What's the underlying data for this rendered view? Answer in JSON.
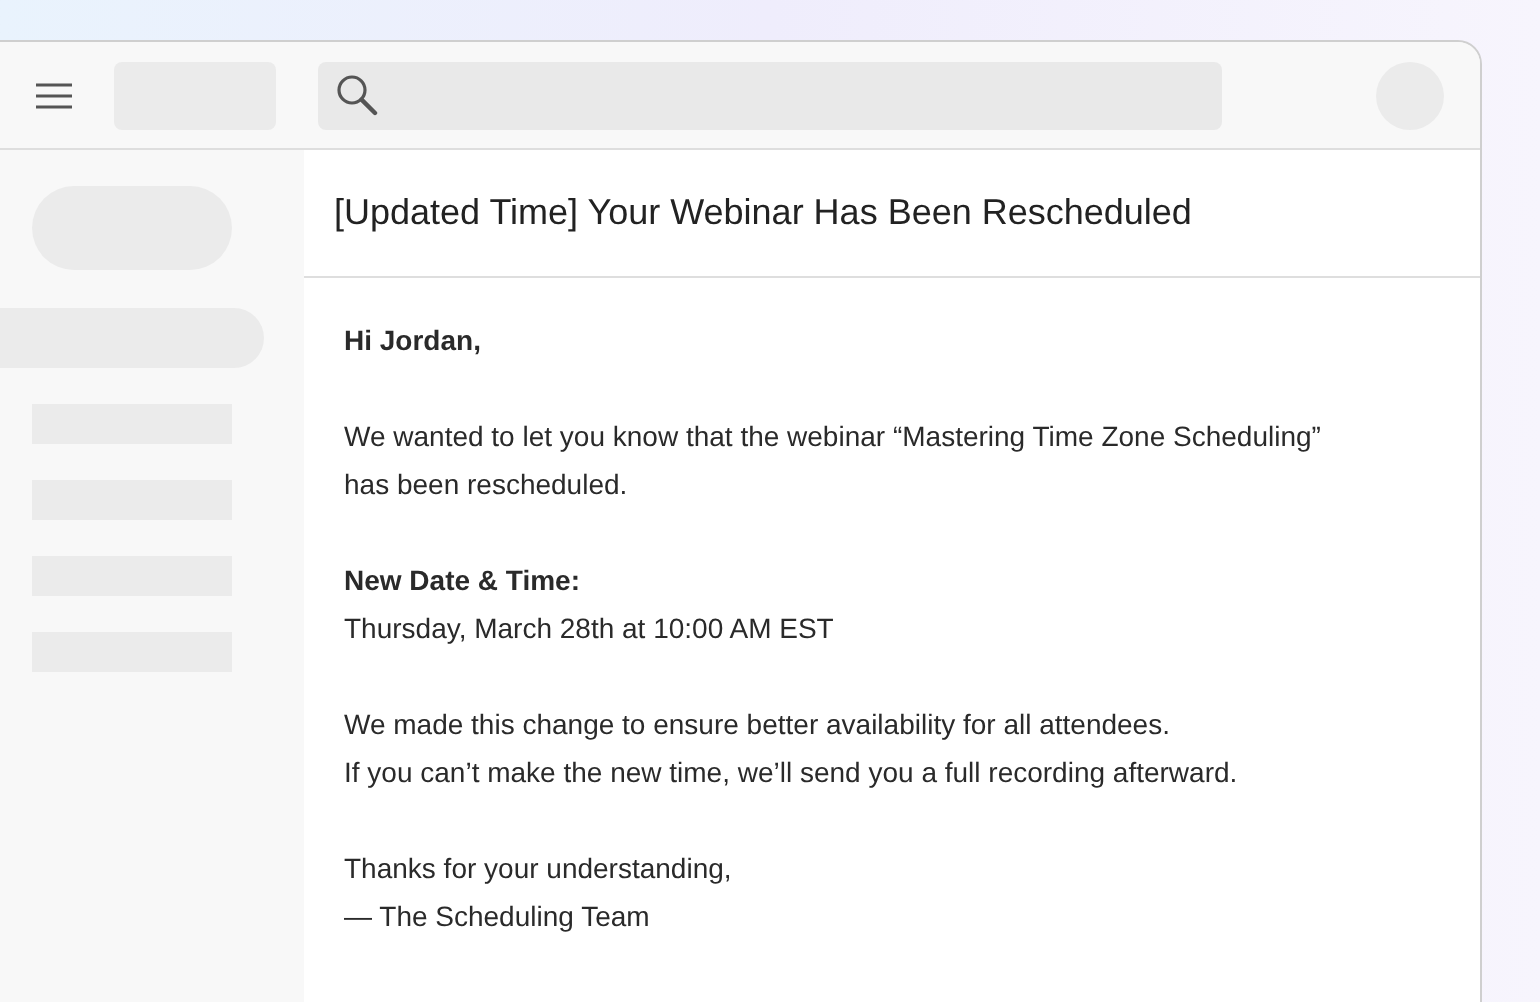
{
  "email": {
    "subject": "[Updated Time] Your Webinar Has Been Rescheduled",
    "blocks": [
      {
        "paragraphs": [
          {
            "kind": "bold",
            "lines": [
              "Hi Jordan,"
            ]
          }
        ]
      },
      {
        "paragraphs": [
          {
            "kind": "text",
            "lines": [
              "We wanted to let you know that the webinar “Mastering Time Zone Scheduling”",
              "has been rescheduled."
            ]
          }
        ]
      },
      {
        "paragraphs": [
          {
            "kind": "bold",
            "lines": [
              "New Date & Time:"
            ]
          },
          {
            "kind": "text",
            "lines": [
              "Thursday, March 28th at 10:00 AM EST"
            ]
          }
        ]
      },
      {
        "paragraphs": [
          {
            "kind": "text",
            "lines": [
              "We made this change to ensure better availability for all attendees."
            ]
          },
          {
            "kind": "text",
            "lines": [
              "If you can’t make the new time, we’ll send you a full recording afterward."
            ]
          }
        ]
      },
      {
        "paragraphs": [
          {
            "kind": "text",
            "lines": [
              "Thanks for your understanding,"
            ]
          },
          {
            "kind": "text",
            "lines": [
              "— The Scheduling Team"
            ]
          }
        ]
      }
    ]
  }
}
